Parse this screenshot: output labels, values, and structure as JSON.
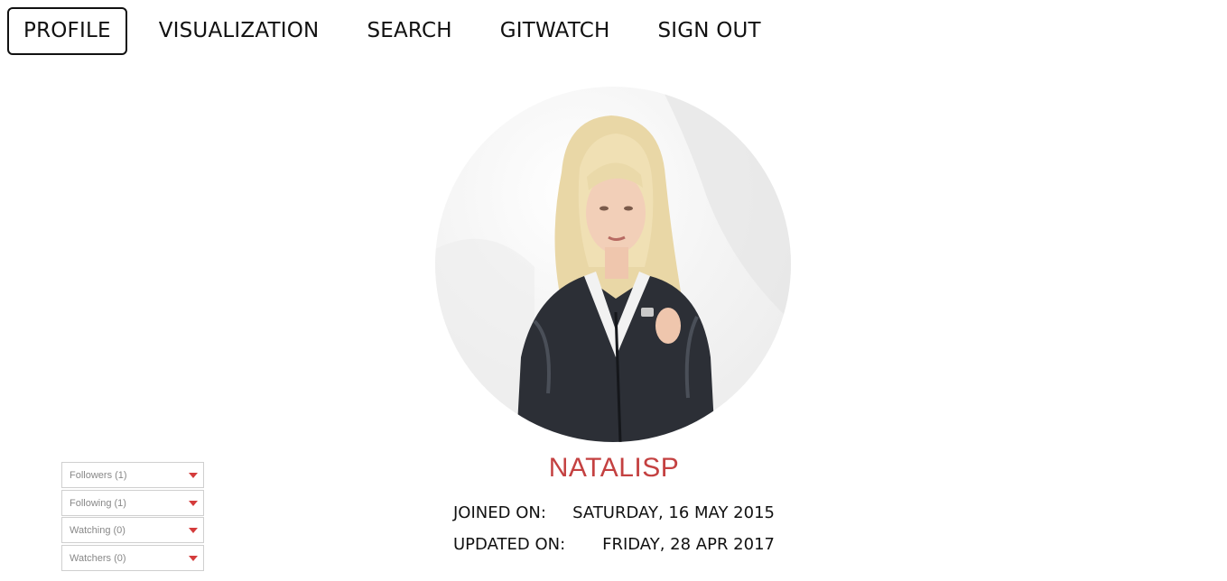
{
  "nav": {
    "items": [
      {
        "label": "PROFILE",
        "active": true
      },
      {
        "label": "VISUALIZATION",
        "active": false
      },
      {
        "label": "SEARCH",
        "active": false
      },
      {
        "label": "GITWATCH",
        "active": false
      },
      {
        "label": "SIGN OUT",
        "active": false
      }
    ]
  },
  "profile": {
    "username": "NATALISP",
    "joined_label": "JOINED ON:",
    "joined_value": "SATURDAY, 16 MAY 2015",
    "updated_label": "UPDATED ON:",
    "updated_value": "FRIDAY, 28 APR 2017"
  },
  "dropdowns": [
    {
      "label": "Followers (1)"
    },
    {
      "label": "Following (1)"
    },
    {
      "label": "Watching (0)"
    },
    {
      "label": "Watchers (0)"
    }
  ],
  "colors": {
    "accent": "#c44141",
    "caret": "#d43b3b"
  },
  "icons": {
    "dropdown_caret": "caret-down-icon"
  }
}
